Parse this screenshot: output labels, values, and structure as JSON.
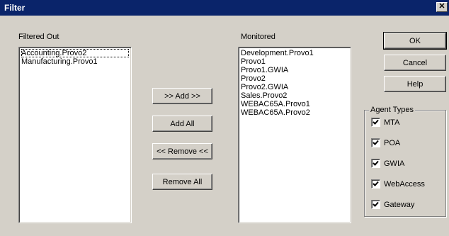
{
  "window": {
    "title": "Filter",
    "close_glyph": "✕"
  },
  "filtered_out": {
    "label": "Filtered Out",
    "items": [
      "Accounting.Provo2",
      "Manufacturing.Provo1"
    ]
  },
  "monitored": {
    "label": "Monitored",
    "items": [
      "Development.Provo1",
      "Provo1",
      "Provo1.GWIA",
      "Provo2",
      "Provo2.GWIA",
      "Sales.Provo2",
      "WEBAC65A.Provo1",
      "WEBAC65A.Provo2"
    ]
  },
  "buttons": {
    "add": ">> Add >>",
    "add_all": "Add All",
    "remove": "<< Remove <<",
    "remove_all": "Remove All",
    "ok": "OK",
    "cancel": "Cancel",
    "help": "Help"
  },
  "agent_types": {
    "label": "Agent Types",
    "items": [
      {
        "label": "MTA",
        "checked": true
      },
      {
        "label": "POA",
        "checked": true
      },
      {
        "label": "GWIA",
        "checked": true
      },
      {
        "label": "WebAccess",
        "checked": true
      },
      {
        "label": "Gateway",
        "checked": true
      }
    ]
  }
}
